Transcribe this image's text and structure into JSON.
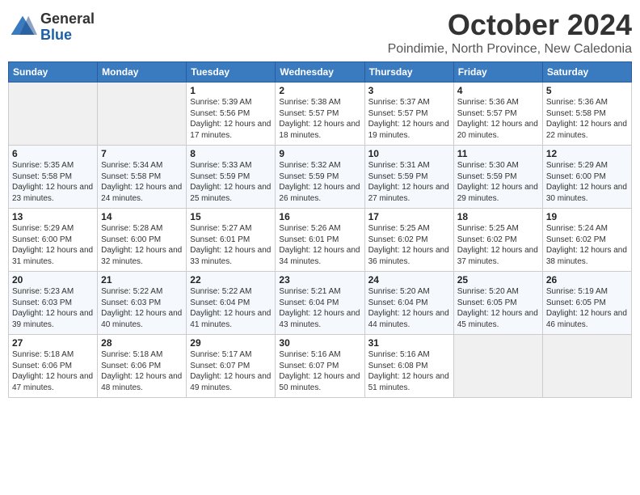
{
  "header": {
    "logo_general": "General",
    "logo_blue": "Blue",
    "month": "October 2024",
    "location": "Poindimie, North Province, New Caledonia"
  },
  "days_of_week": [
    "Sunday",
    "Monday",
    "Tuesday",
    "Wednesday",
    "Thursday",
    "Friday",
    "Saturday"
  ],
  "weeks": [
    [
      {
        "day": "",
        "info": ""
      },
      {
        "day": "",
        "info": ""
      },
      {
        "day": "1",
        "info": "Sunrise: 5:39 AM\nSunset: 5:56 PM\nDaylight: 12 hours\nand 17 minutes."
      },
      {
        "day": "2",
        "info": "Sunrise: 5:38 AM\nSunset: 5:57 PM\nDaylight: 12 hours\nand 18 minutes."
      },
      {
        "day": "3",
        "info": "Sunrise: 5:37 AM\nSunset: 5:57 PM\nDaylight: 12 hours\nand 19 minutes."
      },
      {
        "day": "4",
        "info": "Sunrise: 5:36 AM\nSunset: 5:57 PM\nDaylight: 12 hours\nand 20 minutes."
      },
      {
        "day": "5",
        "info": "Sunrise: 5:36 AM\nSunset: 5:58 PM\nDaylight: 12 hours\nand 22 minutes."
      }
    ],
    [
      {
        "day": "6",
        "info": "Sunrise: 5:35 AM\nSunset: 5:58 PM\nDaylight: 12 hours\nand 23 minutes."
      },
      {
        "day": "7",
        "info": "Sunrise: 5:34 AM\nSunset: 5:58 PM\nDaylight: 12 hours\nand 24 minutes."
      },
      {
        "day": "8",
        "info": "Sunrise: 5:33 AM\nSunset: 5:59 PM\nDaylight: 12 hours\nand 25 minutes."
      },
      {
        "day": "9",
        "info": "Sunrise: 5:32 AM\nSunset: 5:59 PM\nDaylight: 12 hours\nand 26 minutes."
      },
      {
        "day": "10",
        "info": "Sunrise: 5:31 AM\nSunset: 5:59 PM\nDaylight: 12 hours\nand 27 minutes."
      },
      {
        "day": "11",
        "info": "Sunrise: 5:30 AM\nSunset: 5:59 PM\nDaylight: 12 hours\nand 29 minutes."
      },
      {
        "day": "12",
        "info": "Sunrise: 5:29 AM\nSunset: 6:00 PM\nDaylight: 12 hours\nand 30 minutes."
      }
    ],
    [
      {
        "day": "13",
        "info": "Sunrise: 5:29 AM\nSunset: 6:00 PM\nDaylight: 12 hours\nand 31 minutes."
      },
      {
        "day": "14",
        "info": "Sunrise: 5:28 AM\nSunset: 6:00 PM\nDaylight: 12 hours\nand 32 minutes."
      },
      {
        "day": "15",
        "info": "Sunrise: 5:27 AM\nSunset: 6:01 PM\nDaylight: 12 hours\nand 33 minutes."
      },
      {
        "day": "16",
        "info": "Sunrise: 5:26 AM\nSunset: 6:01 PM\nDaylight: 12 hours\nand 34 minutes."
      },
      {
        "day": "17",
        "info": "Sunrise: 5:25 AM\nSunset: 6:02 PM\nDaylight: 12 hours\nand 36 minutes."
      },
      {
        "day": "18",
        "info": "Sunrise: 5:25 AM\nSunset: 6:02 PM\nDaylight: 12 hours\nand 37 minutes."
      },
      {
        "day": "19",
        "info": "Sunrise: 5:24 AM\nSunset: 6:02 PM\nDaylight: 12 hours\nand 38 minutes."
      }
    ],
    [
      {
        "day": "20",
        "info": "Sunrise: 5:23 AM\nSunset: 6:03 PM\nDaylight: 12 hours\nand 39 minutes."
      },
      {
        "day": "21",
        "info": "Sunrise: 5:22 AM\nSunset: 6:03 PM\nDaylight: 12 hours\nand 40 minutes."
      },
      {
        "day": "22",
        "info": "Sunrise: 5:22 AM\nSunset: 6:04 PM\nDaylight: 12 hours\nand 41 minutes."
      },
      {
        "day": "23",
        "info": "Sunrise: 5:21 AM\nSunset: 6:04 PM\nDaylight: 12 hours\nand 43 minutes."
      },
      {
        "day": "24",
        "info": "Sunrise: 5:20 AM\nSunset: 6:04 PM\nDaylight: 12 hours\nand 44 minutes."
      },
      {
        "day": "25",
        "info": "Sunrise: 5:20 AM\nSunset: 6:05 PM\nDaylight: 12 hours\nand 45 minutes."
      },
      {
        "day": "26",
        "info": "Sunrise: 5:19 AM\nSunset: 6:05 PM\nDaylight: 12 hours\nand 46 minutes."
      }
    ],
    [
      {
        "day": "27",
        "info": "Sunrise: 5:18 AM\nSunset: 6:06 PM\nDaylight: 12 hours\nand 47 minutes."
      },
      {
        "day": "28",
        "info": "Sunrise: 5:18 AM\nSunset: 6:06 PM\nDaylight: 12 hours\nand 48 minutes."
      },
      {
        "day": "29",
        "info": "Sunrise: 5:17 AM\nSunset: 6:07 PM\nDaylight: 12 hours\nand 49 minutes."
      },
      {
        "day": "30",
        "info": "Sunrise: 5:16 AM\nSunset: 6:07 PM\nDaylight: 12 hours\nand 50 minutes."
      },
      {
        "day": "31",
        "info": "Sunrise: 5:16 AM\nSunset: 6:08 PM\nDaylight: 12 hours\nand 51 minutes."
      },
      {
        "day": "",
        "info": ""
      },
      {
        "day": "",
        "info": ""
      }
    ]
  ]
}
